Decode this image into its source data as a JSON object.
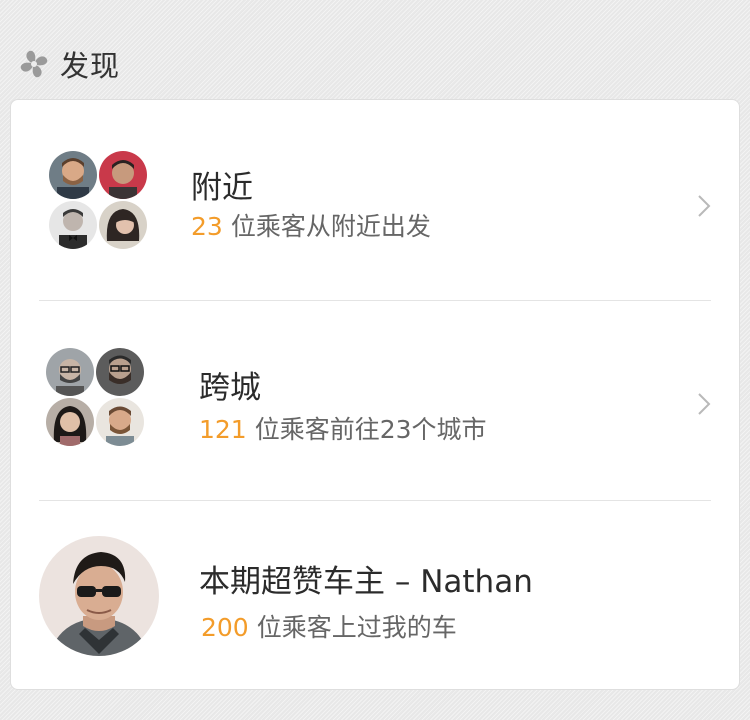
{
  "section": {
    "title": "发现",
    "icon": "fan-icon"
  },
  "items": [
    {
      "title": "附近",
      "count": "23",
      "subtitle": "位乘客从附近出发",
      "avatars": [
        "avatar-bearded-man",
        "avatar-man-red-bg",
        "avatar-man-bowtie",
        "avatar-woman-bangs"
      ],
      "chevron": "chevron-right-icon"
    },
    {
      "title": "跨城",
      "count": "121",
      "subtitle": "位乘客前往23个城市",
      "avatars": [
        "avatar-man-glasses-grey",
        "avatar-man-beard-glasses",
        "avatar-woman-dark-hair",
        "avatar-man-beard"
      ],
      "chevron": "chevron-right-icon"
    },
    {
      "title": "本期超赞车主 – Nathan",
      "count": "200",
      "subtitle": "位乘客上过我的车",
      "avatars": [
        "avatar-nathan"
      ]
    }
  ],
  "colors": {
    "accent": "#f39c2a",
    "title": "#2b2b2b",
    "subtitle": "#666666"
  }
}
